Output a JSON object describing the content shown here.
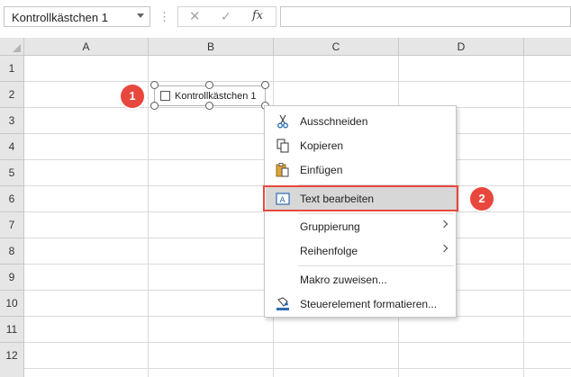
{
  "formula_bar": {
    "name_box": "Kontrollkästchen 1",
    "separator": "⋮",
    "cancel_glyph": "✕",
    "enter_glyph": "✓",
    "fx_label": "fx",
    "formula_value": ""
  },
  "columns": [
    "A",
    "B",
    "C",
    "D"
  ],
  "rows": [
    "1",
    "2",
    "3",
    "4",
    "5",
    "6",
    "7",
    "8",
    "9",
    "10",
    "11",
    "12"
  ],
  "form_control": {
    "label": "Kontrollkästchen 1",
    "checked": false
  },
  "badges": {
    "step1": "1",
    "step2": "2",
    "color": "#e8473d"
  },
  "context_menu": {
    "items": [
      {
        "label": "Ausschneiden",
        "icon": "scissors-icon"
      },
      {
        "label": "Kopieren",
        "icon": "copy-icon"
      },
      {
        "label": "Einfügen",
        "icon": "paste-icon"
      },
      {
        "label": "Text bearbeiten",
        "icon": "edit-text-icon",
        "highlighted": true
      },
      {
        "label": "Gruppierung",
        "submenu": true
      },
      {
        "label": "Reihenfolge",
        "submenu": true
      },
      {
        "label": "Makro zuweisen...",
        "icon": ""
      },
      {
        "label": "Steuerelement formatieren...",
        "icon": "format-control-icon"
      }
    ]
  }
}
